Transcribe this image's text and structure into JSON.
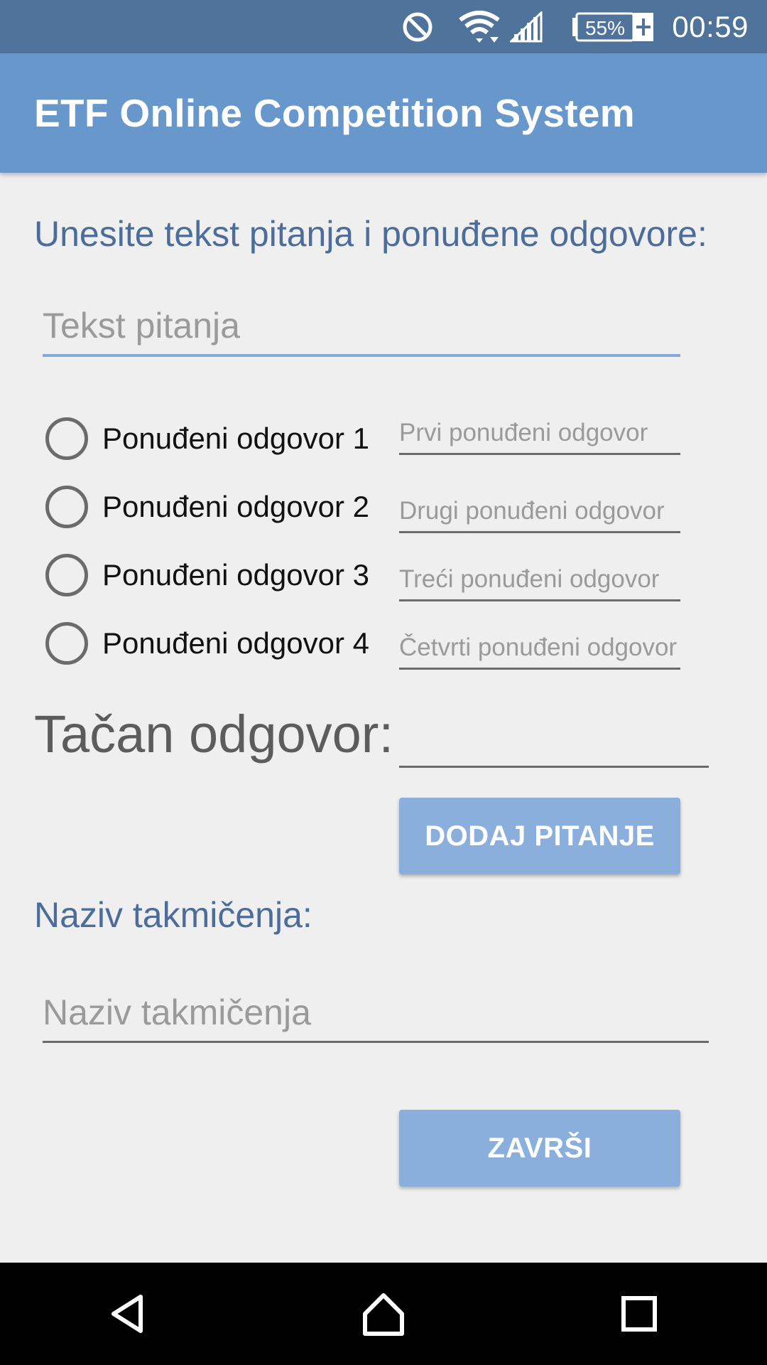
{
  "status_bar": {
    "time": "00:59",
    "battery_percent": "55%",
    "icons": [
      "do-not-disturb-icon",
      "wifi-icon",
      "signal-icon",
      "battery-charging-icon"
    ]
  },
  "app_bar": {
    "title": "ETF Online Competition System"
  },
  "question_section": {
    "heading": "Unesite tekst pitanja i ponuđene odgovore:",
    "question_placeholder": "Tekst pitanja",
    "question_value": ""
  },
  "answers": [
    {
      "label": "Ponuđeni odgovor 1",
      "placeholder": "Prvi ponuđeni odgovor",
      "selected": false
    },
    {
      "label": "Ponuđeni odgovor 2",
      "placeholder": "Drugi ponuđeni odgovor",
      "selected": false
    },
    {
      "label": "Ponuđeni odgovor 3",
      "placeholder": "Treći ponuđeni odgovor",
      "selected": false
    },
    {
      "label": "Ponuđeni odgovor 4",
      "placeholder": "Četvrti ponuđeni odgovor",
      "selected": false
    }
  ],
  "correct_answer": {
    "label": "Tačan odgovor:",
    "value": ""
  },
  "add_question_button": "DODAJ PITANJE",
  "competition": {
    "heading": "Naziv takmičenja:",
    "placeholder": "Naziv takmičenja",
    "value": ""
  },
  "finish_button": "ZAVRŠI",
  "colors": {
    "status_bar": "#4f739b",
    "app_bar": "#6797cb",
    "button": "#8aafdd",
    "heading": "#4c6c99"
  }
}
